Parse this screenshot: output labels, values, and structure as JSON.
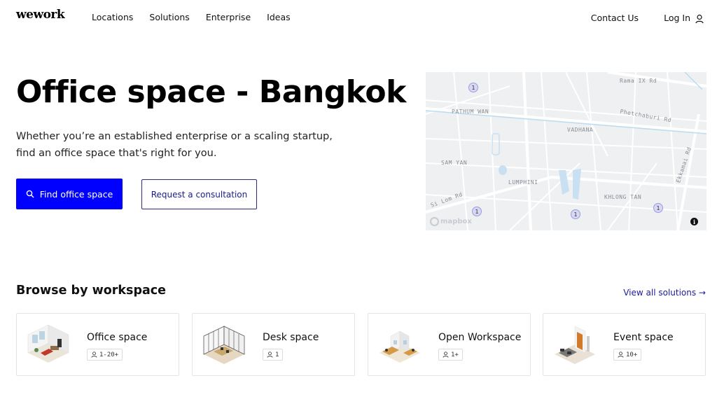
{
  "header": {
    "logo": "wework",
    "nav": [
      "Locations",
      "Solutions",
      "Enterprise",
      "Ideas"
    ],
    "contact": "Contact Us",
    "login": "Log In"
  },
  "hero": {
    "title": "Office space - Bangkok",
    "subtitle": "Whether you’re an established enterprise or a scaling startup, find an office space that's right for you.",
    "primary_button": "Find office space",
    "secondary_button": "Request a consultation"
  },
  "map": {
    "labels": {
      "rama_ix": "Rama IX Rd",
      "pathum_wan": "PATHUM WAN",
      "phetchaburi": "Phetchaburi Rd",
      "vadhana": "VADHANA",
      "sam_yan": "SAM YAN",
      "lumphini": "LUMPHINI",
      "silom": "Si Lom Rd",
      "khlong_tan": "KHLONG TAN",
      "ekkamai": "Ekkamai Rd"
    },
    "pin_count": "1",
    "attribution": "mapbox",
    "info": "i"
  },
  "browse": {
    "title": "Browse by workspace",
    "view_all": "View all solutions →",
    "cards": [
      {
        "title": "Office space",
        "capacity": "1-20+"
      },
      {
        "title": "Desk space",
        "capacity": "1"
      },
      {
        "title": "Open Workspace",
        "capacity": "1+"
      },
      {
        "title": "Event space",
        "capacity": "10+"
      }
    ]
  },
  "colors": {
    "primary": "#0000ff",
    "link": "#1a1a9c",
    "map_bg": "#eef0f2"
  }
}
